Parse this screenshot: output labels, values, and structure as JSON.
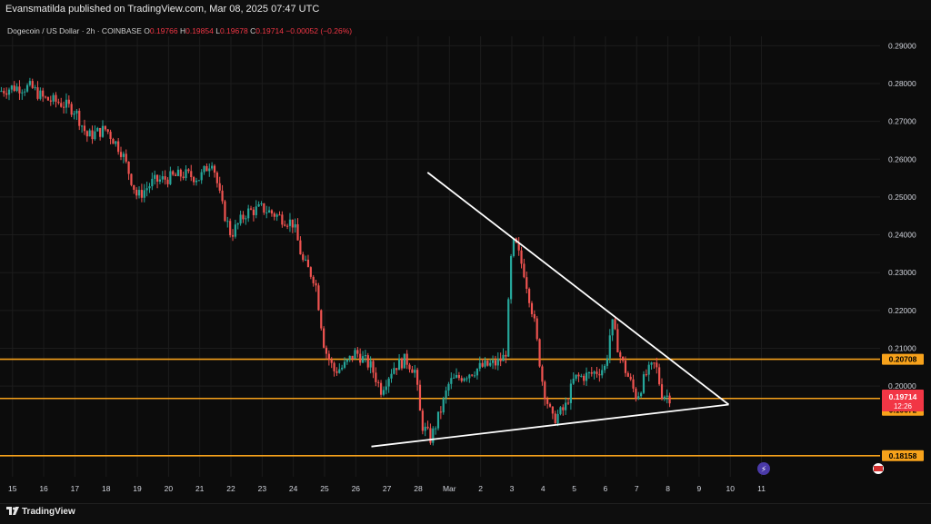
{
  "header": {
    "publisher_text": "Evansmatilda published on TradingView.com, Mar 08, 2025 07:47 UTC"
  },
  "legend": {
    "symbol": "Dogecoin / US Dollar · 2h · COINBASE",
    "open_label": "O",
    "open": "0.19766",
    "high_label": "H",
    "high": "0.19854",
    "low_label": "L",
    "low": "0.19678",
    "close_label": "C",
    "close": "0.19714",
    "change": "−0.00052 (−0.26%)"
  },
  "footer": {
    "brand": "TradingView"
  },
  "colors": {
    "up": "#26a69a",
    "down": "#ef5350",
    "level": "#f7a21b",
    "price_badge": "#f23645",
    "trend": "#ffffff",
    "grid": "#1c1c1c"
  },
  "price_badges": {
    "current_price": "0.19714",
    "countdown": "12:26",
    "level_top": "0.20708",
    "level_mid": "0.19672",
    "level_bottom": "0.18158"
  },
  "chart_data": {
    "type": "candlestick",
    "y_axis": {
      "ylim": [
        0.176,
        0.2925
      ],
      "ticks": [
        "0.29000",
        "0.28000",
        "0.27000",
        "0.26000",
        "0.25000",
        "0.24000",
        "0.23000",
        "0.22000",
        "0.21000",
        "0.20000"
      ]
    },
    "x_axis": {
      "xlim": [
        14.6,
        42.8
      ],
      "ticks": [
        {
          "x": 15,
          "label": "15"
        },
        {
          "x": 16,
          "label": "16"
        },
        {
          "x": 17,
          "label": "17"
        },
        {
          "x": 18,
          "label": "18"
        },
        {
          "x": 19,
          "label": "19"
        },
        {
          "x": 20,
          "label": "20"
        },
        {
          "x": 21,
          "label": "21"
        },
        {
          "x": 22,
          "label": "22"
        },
        {
          "x": 23,
          "label": "23"
        },
        {
          "x": 24,
          "label": "24"
        },
        {
          "x": 25,
          "label": "25"
        },
        {
          "x": 26,
          "label": "26"
        },
        {
          "x": 27,
          "label": "27"
        },
        {
          "x": 28,
          "label": "28"
        },
        {
          "x": 29,
          "label": "Mar"
        },
        {
          "x": 30,
          "label": "2"
        },
        {
          "x": 31,
          "label": "3"
        },
        {
          "x": 32,
          "label": "4"
        },
        {
          "x": 33,
          "label": "5"
        },
        {
          "x": 34,
          "label": "6"
        },
        {
          "x": 35,
          "label": "7"
        },
        {
          "x": 36,
          "label": "8"
        },
        {
          "x": 37,
          "label": "9"
        },
        {
          "x": 38,
          "label": "10"
        },
        {
          "x": 39,
          "label": "11"
        }
      ]
    },
    "horizontal_levels": [
      0.20708,
      0.19672,
      0.18158
    ],
    "trendlines": [
      {
        "from": [
          28.3,
          0.2565
        ],
        "to": [
          37.95,
          0.1951
        ]
      },
      {
        "from": [
          26.5,
          0.184
        ],
        "to": [
          37.95,
          0.1951
        ]
      }
    ],
    "price_path": [
      [
        14.6,
        0.278
      ],
      [
        15.0,
        0.279
      ],
      [
        15.6,
        0.279
      ],
      [
        16.0,
        0.276
      ],
      [
        16.5,
        0.275
      ],
      [
        17.0,
        0.273
      ],
      [
        17.4,
        0.266
      ],
      [
        18.0,
        0.268
      ],
      [
        18.5,
        0.262
      ],
      [
        19.0,
        0.25
      ],
      [
        19.5,
        0.254
      ],
      [
        20.0,
        0.255
      ],
      [
        20.5,
        0.256
      ],
      [
        21.0,
        0.255
      ],
      [
        21.4,
        0.26
      ],
      [
        21.7,
        0.248
      ],
      [
        22.0,
        0.24
      ],
      [
        22.5,
        0.246
      ],
      [
        23.0,
        0.247
      ],
      [
        23.5,
        0.245
      ],
      [
        24.0,
        0.243
      ],
      [
        24.3,
        0.233
      ],
      [
        24.7,
        0.228
      ],
      [
        25.0,
        0.21
      ],
      [
        25.3,
        0.204
      ],
      [
        25.6,
        0.205
      ],
      [
        26.0,
        0.209
      ],
      [
        26.5,
        0.205
      ],
      [
        26.8,
        0.199
      ],
      [
        27.2,
        0.205
      ],
      [
        27.6,
        0.207
      ],
      [
        27.9,
        0.204
      ],
      [
        28.1,
        0.19
      ],
      [
        28.4,
        0.186
      ],
      [
        28.7,
        0.193
      ],
      [
        29.0,
        0.201
      ],
      [
        29.5,
        0.203
      ],
      [
        30.0,
        0.205
      ],
      [
        30.5,
        0.206
      ],
      [
        30.8,
        0.208
      ],
      [
        31.0,
        0.237
      ],
      [
        31.1,
        0.238
      ],
      [
        31.4,
        0.23
      ],
      [
        31.7,
        0.218
      ],
      [
        32.0,
        0.2
      ],
      [
        32.3,
        0.191
      ],
      [
        32.7,
        0.194
      ],
      [
        33.0,
        0.202
      ],
      [
        33.5,
        0.203
      ],
      [
        34.0,
        0.205
      ],
      [
        34.2,
        0.217
      ],
      [
        34.5,
        0.207
      ],
      [
        35.0,
        0.197
      ],
      [
        35.3,
        0.203
      ],
      [
        35.6,
        0.206
      ],
      [
        35.8,
        0.198
      ],
      [
        36.1,
        0.197
      ]
    ]
  }
}
